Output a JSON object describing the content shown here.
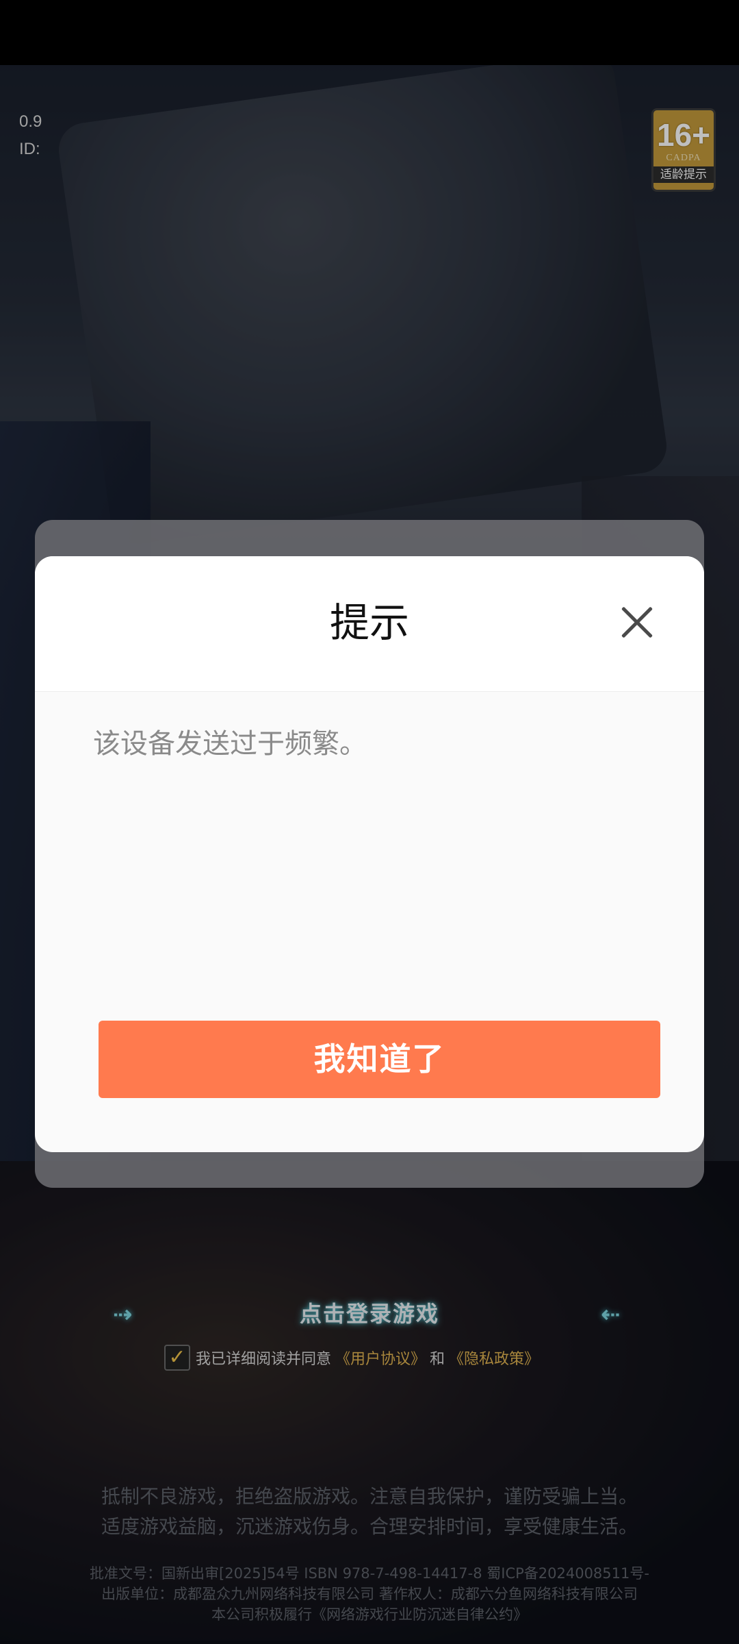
{
  "version": {
    "line1": "0.9",
    "line2": "ID:"
  },
  "age_badge": {
    "rating": "16+",
    "org": "CADPA",
    "tip": "适龄提示"
  },
  "login": {
    "button_label": "点击登录游戏",
    "arrow_left": "⇢",
    "arrow_right": "⇠"
  },
  "agreement": {
    "prefix": "我已详细阅读并同意",
    "user_agreement": "《用户协议》",
    "and": "和",
    "privacy_policy": "《隐私政策》"
  },
  "notice": {
    "line1": "抵制不良游戏，拒绝盗版游戏。注意自我保护，谨防受骗上当。",
    "line2": "适度游戏益脑，沉迷游戏伤身。合理安排时间，享受健康生活。"
  },
  "legal": {
    "line1": "批准文号：国新出审[2025]54号 ISBN 978-7-498-14417-8 蜀ICP备2024008511号-",
    "line2": "出版单位：成都盈众九州网络科技有限公司 著作权人：成都六分鱼网络科技有限公司",
    "line3": "本公司积极履行《网络游戏行业防沉迷自律公约》"
  },
  "dialog": {
    "title": "提示",
    "message": "该设备发送过于频繁。",
    "ok_label": "我知道了"
  },
  "colors": {
    "primary_button": "#ff7a4e",
    "badge_gold": "#c39a3b",
    "link_gold": "#e0b350"
  }
}
